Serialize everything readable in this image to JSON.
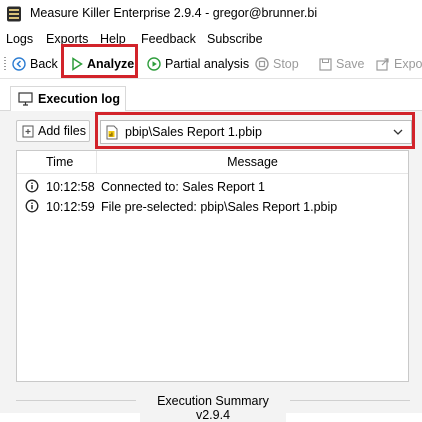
{
  "window": {
    "title": "Measure Killer Enterprise 2.9.4 - gregor@brunner.bi",
    "app_icon": "measure-killer-logo"
  },
  "menu": {
    "items": [
      "Logs",
      "Exports",
      "Help",
      "Feedback",
      "Subscribe"
    ]
  },
  "toolbar": {
    "back_label": "Back",
    "analyze_label": "Analyze",
    "partial_label": "Partial analysis",
    "stop_label": "Stop",
    "save_label": "Save",
    "export_label": "Expor"
  },
  "tab": {
    "label": "Execution log"
  },
  "files": {
    "add_label": "Add files",
    "selected": "pbip\\Sales Report 1.pbip"
  },
  "log": {
    "columns": {
      "time": "Time",
      "message": "Message"
    },
    "rows": [
      {
        "time": "10:12:58",
        "message": "Connected to: Sales Report 1"
      },
      {
        "time": "10:12:59",
        "message": "File pre-selected: pbip\\Sales Report 1.pbip"
      }
    ]
  },
  "summary": {
    "title": "Execution Summary v2.9.4"
  },
  "colors": {
    "highlight": "#d2232a",
    "accent_blue": "#2d7dd2",
    "play_green": "#2e9d3c",
    "panel_bg": "#f3f3f3"
  }
}
